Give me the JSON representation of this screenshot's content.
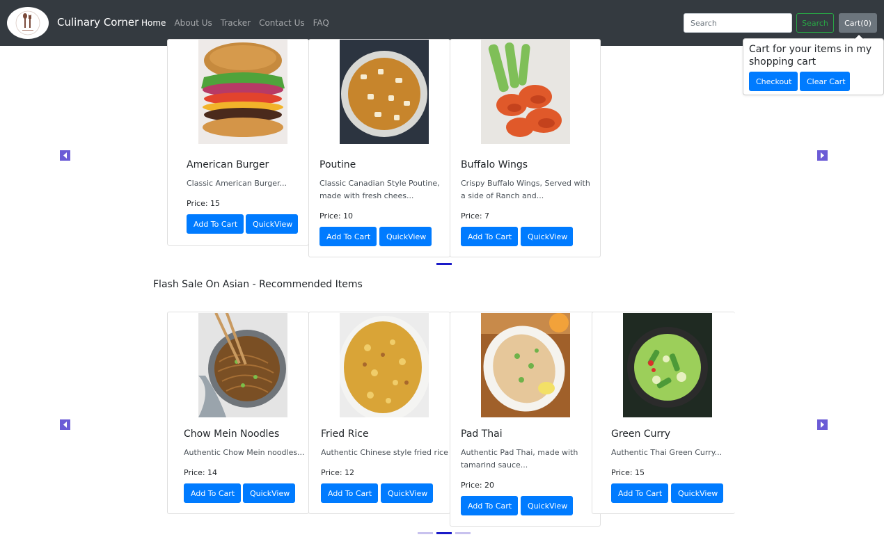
{
  "nav": {
    "brand": "Culinary Corner",
    "links": [
      "Home",
      "About Us",
      "Tracker",
      "Contact Us",
      "FAQ"
    ],
    "active_link": "Home",
    "search_placeholder": "Search",
    "search_button": "Search",
    "cart_button": "Cart(0)"
  },
  "cart_popover": {
    "text": "Cart for your items in my shopping cart",
    "checkout_button": "Checkout",
    "clear_button": "Clear Cart"
  },
  "carousel_1": {
    "items": [
      {
        "name": "American Burger",
        "description": "Classic American Burger...",
        "price": "Price: 15",
        "add_label": "Add To Cart",
        "quickview_label": "QuickView"
      },
      {
        "name": "Poutine",
        "description": "Classic Canadian Style Poutine, made with fresh chees...",
        "price": "Price: 10",
        "add_label": "Add To Cart",
        "quickview_label": "QuickView"
      },
      {
        "name": "Buffalo Wings",
        "description": "Crispy Buffalo Wings, Served with a side of Ranch and...",
        "price": "Price: 7",
        "add_label": "Add To Cart",
        "quickview_label": "QuickView"
      }
    ]
  },
  "section_asian": {
    "title": "Flash Sale On Asian - Recommended Items",
    "items": [
      {
        "name": "Chow Mein Noodles",
        "description": "Authentic Chow Mein noodles...",
        "price": "Price: 14",
        "add_label": "Add To Cart",
        "quickview_label": "QuickView"
      },
      {
        "name": "Fried Rice",
        "description": "Authentic Chinese style fried rice...",
        "price": "Price: 12",
        "add_label": "Add To Cart",
        "quickview_label": "QuickView"
      },
      {
        "name": "Pad Thai",
        "description": "Authentic Pad Thai, made with tamarind sauce...",
        "price": "Price: 20",
        "add_label": "Add To Cart",
        "quickview_label": "QuickView"
      },
      {
        "name": "Green Curry",
        "description": "Authentic Thai Green Curry...",
        "price": "Price: 15",
        "add_label": "Add To Cart",
        "quickview_label": "QuickView"
      }
    ]
  },
  "icons": {
    "prev": "chevron-left-icon",
    "next": "chevron-right-icon",
    "logo": "utensils-logo-icon"
  },
  "colors": {
    "navbar": "#343a40",
    "primary": "#007bff",
    "success": "#28a745",
    "secondary": "#6c757d",
    "carousel_control": "#6b5bd6",
    "indicator_active": "#1a1ac8",
    "indicator_inactive": "#c8c2ee"
  }
}
